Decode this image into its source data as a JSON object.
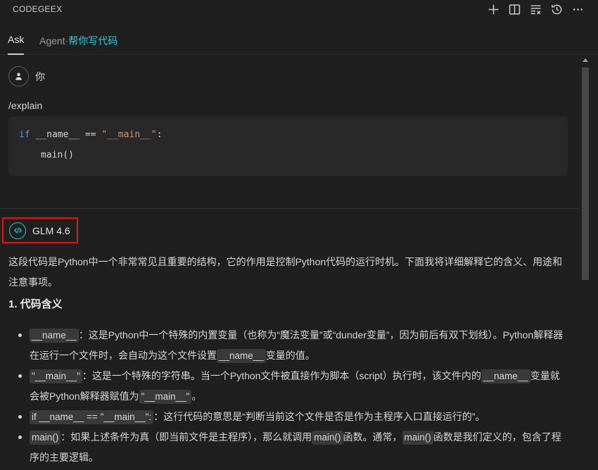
{
  "titlebar": {
    "title": "CODEGEEX",
    "actions": [
      "plus-icon",
      "split-panel-icon",
      "clear-list-icon",
      "history-icon",
      "more-icon"
    ]
  },
  "tabs": {
    "ask": "Ask",
    "agent_prefix": "Agent·",
    "agent_accent": "帮你写代码"
  },
  "user": {
    "name": "你",
    "command": "/explain"
  },
  "code": {
    "kw_if": "if",
    "name_var": " __name__ == ",
    "main_str": "\"__main__\"",
    "colon": ":",
    "line2": "main()"
  },
  "model": {
    "name": "GLM 4.6"
  },
  "answer": {
    "intro": "这段代码是Python中一个非常常见且重要的结构，它的作用是控制Python代码的运行时机。下面我将详细解释它的含义、用途和注意事项。",
    "section1": "1. 代码含义",
    "b1": {
      "code": "__name__",
      "text1": "：这是Python中一个特殊的内置变量（也称为“魔法变量”或“dunder变量”，因为前后有双下划线）。Python解释器在运行一个文件时，会自动为这个文件设置",
      "code2": "__name__",
      "text2": "变量的值。"
    },
    "b2": {
      "code": "\"__main__\"",
      "text1": "：这是一个特殊的字符串。当一个Python文件被直接作为脚本（script）执行时，该文件内的",
      "code2": "__name__",
      "text2": "变量就会被Python解释器赋值为",
      "code3": "\"__main__\"",
      "text3": "。"
    },
    "b3": {
      "code": "if __name__ == \"__main__\":",
      "text1": "：这行代码的意思是“判断当前这个文件是否是作为主程序入口直接运行的”。"
    },
    "b4": {
      "code": "main()",
      "text1": "：如果上述条件为真（即当前文件是主程序），那么就调用",
      "code2": "main()",
      "text2": "函数。通常，",
      "code3": "main()",
      "text3": "函数是我们定义的，包含了程序的主要逻辑。"
    }
  }
}
